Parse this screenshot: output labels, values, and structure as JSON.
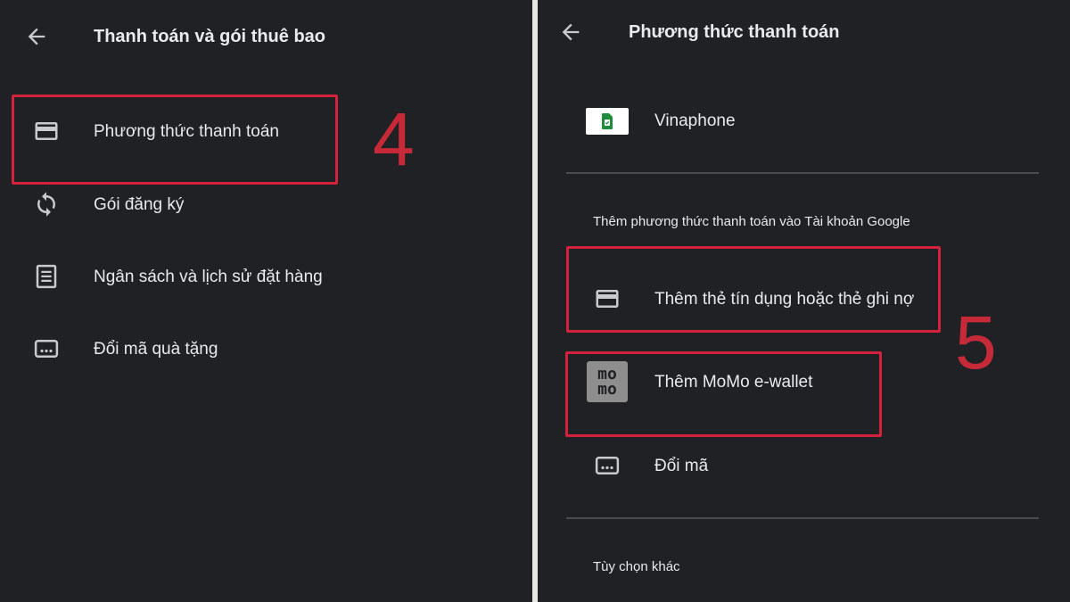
{
  "left": {
    "title": "Thanh toán và gói thuê bao",
    "items": [
      {
        "label": "Phương thức thanh toán",
        "icon": "credit-card-icon"
      },
      {
        "label": "Gói đăng ký",
        "icon": "sync-icon"
      },
      {
        "label": "Ngân sách và lịch sử đặt hàng",
        "icon": "receipt-icon"
      },
      {
        "label": "Đổi mã quà tặng",
        "icon": "redeem-code-icon"
      }
    ],
    "step": "4"
  },
  "right": {
    "title": "Phương thức thanh toán",
    "existing_method": {
      "label": "Vinaphone",
      "icon": "vinaphone-sim-icon"
    },
    "add_section_label": "Thêm phương thức thanh toán vào Tài khoản Google",
    "items": [
      {
        "label": "Thêm thẻ tín dụng hoặc thẻ ghi nợ",
        "icon": "credit-card-icon"
      },
      {
        "label": "Thêm MoMo e-wallet",
        "icon": "momo-logo-icon",
        "logo_text": [
          "mo",
          "mo"
        ]
      },
      {
        "label": "Đổi mã",
        "icon": "redeem-code-icon"
      }
    ],
    "other_options_label": "Tùy chọn khác",
    "step": "5"
  },
  "colors": {
    "background": "#202124",
    "text": "#e8eaed",
    "highlight": "#d4213d",
    "step_number": "#c62a38",
    "divider": "#4a4b4e"
  }
}
